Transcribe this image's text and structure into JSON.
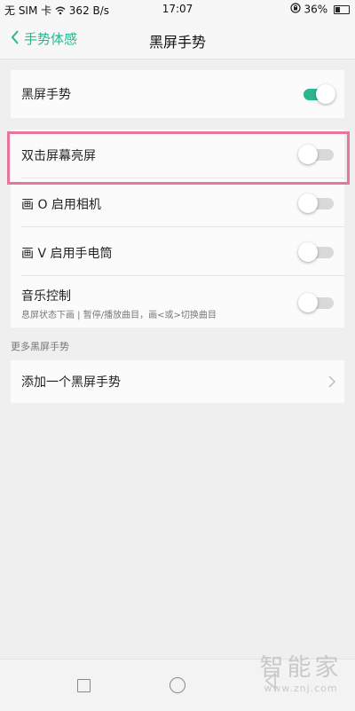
{
  "status_bar": {
    "carrier": "无 SIM 卡",
    "speed": "362 B/s",
    "time": "17:07",
    "battery": "36%",
    "battery_level": 0.36
  },
  "nav": {
    "back_label": "手势体感",
    "title": "黑屏手势"
  },
  "master": {
    "label": "黑屏手势",
    "on": true
  },
  "gestures": [
    {
      "label": "双击屏幕亮屏",
      "on": false
    },
    {
      "label": "画 O 启用相机",
      "on": false
    },
    {
      "label": "画 V 启用手电筒",
      "on": false
    },
    {
      "label": "音乐控制",
      "subtitle": "息屏状态下画 | 暂停/播放曲目，画<或>切换曲目",
      "on": false
    }
  ],
  "more_section": {
    "label": "更多黑屏手势",
    "add_label": "添加一个黑屏手势"
  },
  "watermark": {
    "text": "智能家",
    "url": "www.znj.com"
  },
  "colors": {
    "accent": "#2bb68e",
    "highlight": "#e8759e"
  }
}
